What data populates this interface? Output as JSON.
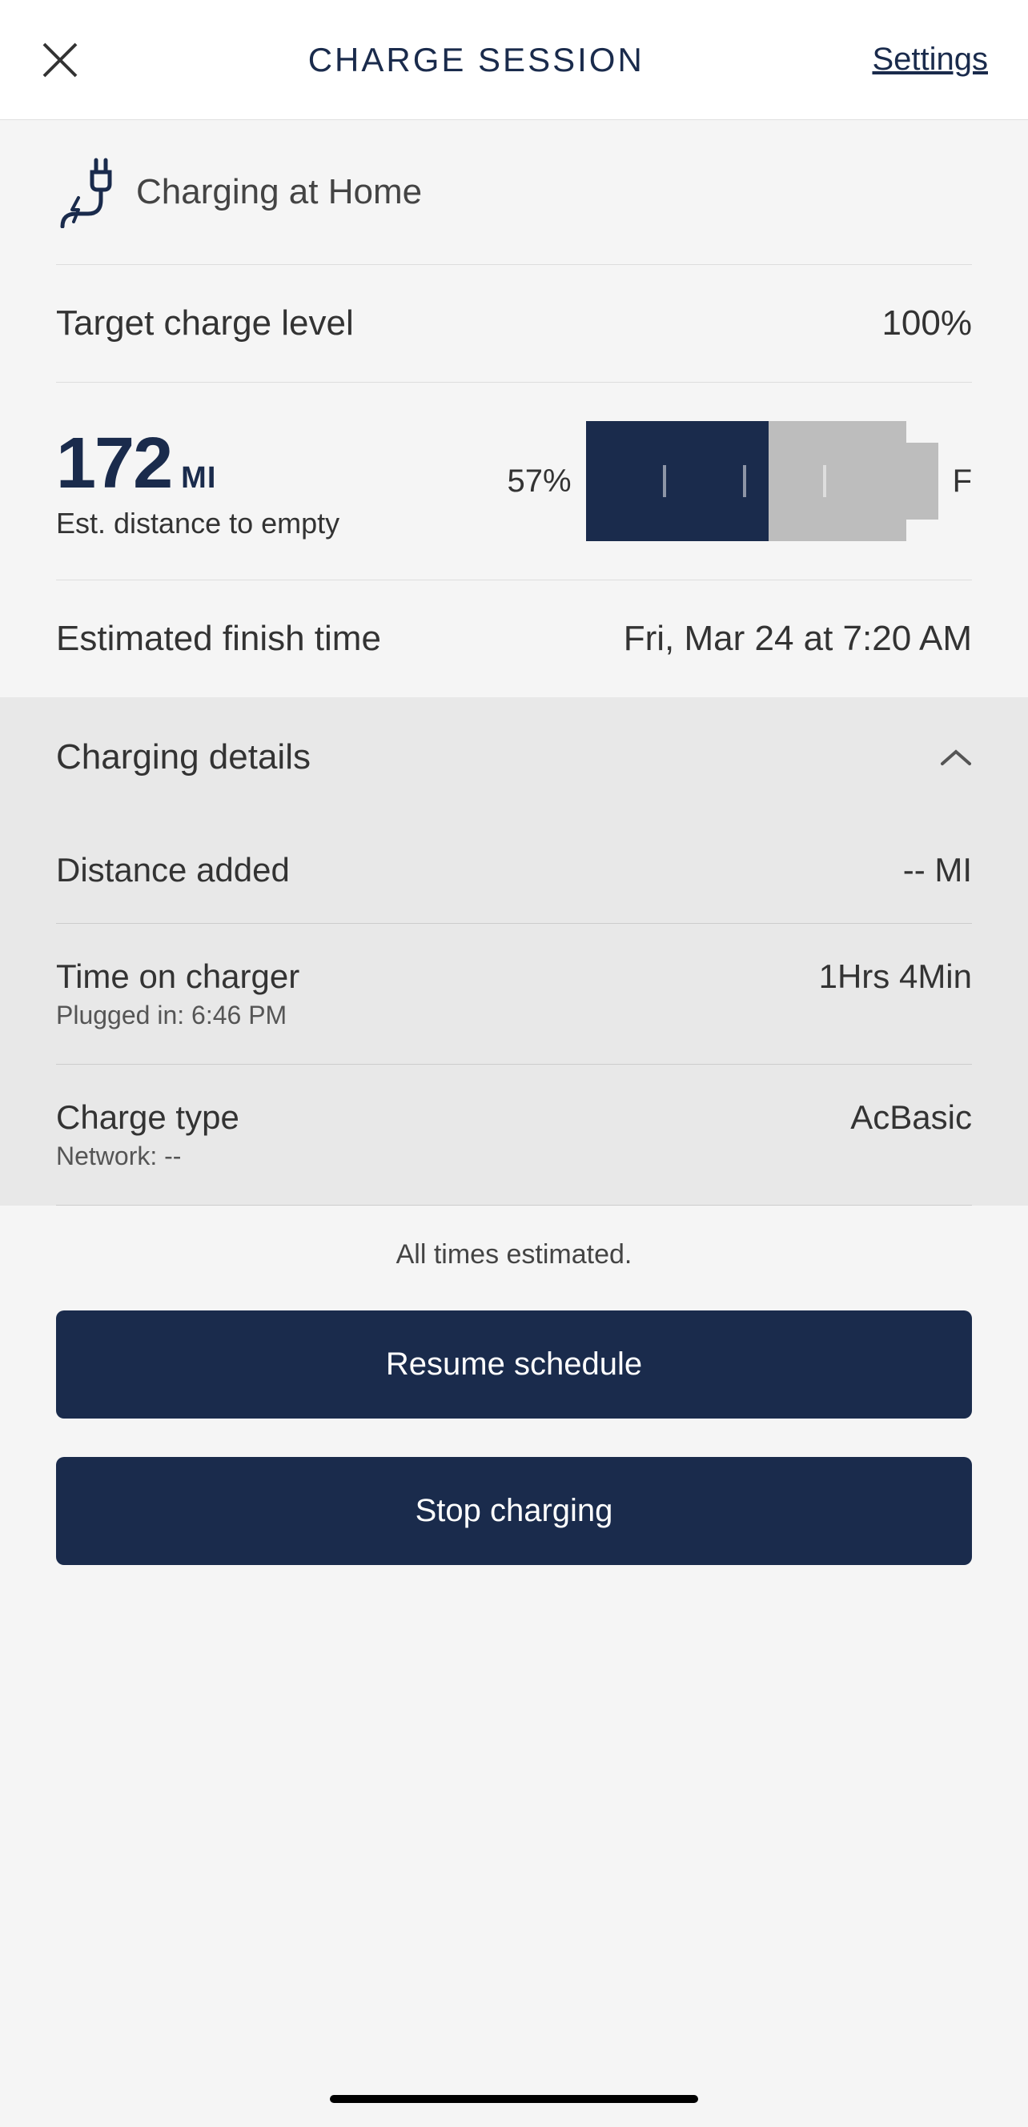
{
  "header": {
    "title": "CHARGE SESSION",
    "settings_label": "Settings"
  },
  "location": {
    "text": "Charging at Home"
  },
  "target": {
    "label": "Target charge level",
    "value": "100%"
  },
  "battery": {
    "distance_value": "172",
    "distance_unit": "MI",
    "distance_label": "Est. distance to empty",
    "percent": "57%",
    "fill_percent": 57,
    "full_label": "F"
  },
  "finish": {
    "label": "Estimated finish time",
    "value": "Fri, Mar 24 at 7:20 AM"
  },
  "details": {
    "title": "Charging details",
    "distance_added": {
      "label": "Distance added",
      "value": "-- MI"
    },
    "time_on_charger": {
      "label": "Time on charger",
      "value": "1Hrs 4Min",
      "sublabel": "Plugged in: 6:46 PM"
    },
    "charge_type": {
      "label": "Charge type",
      "value": "AcBasic",
      "sublabel": "Network: --"
    }
  },
  "note": "All times estimated.",
  "buttons": {
    "resume": "Resume schedule",
    "stop": "Stop charging"
  }
}
